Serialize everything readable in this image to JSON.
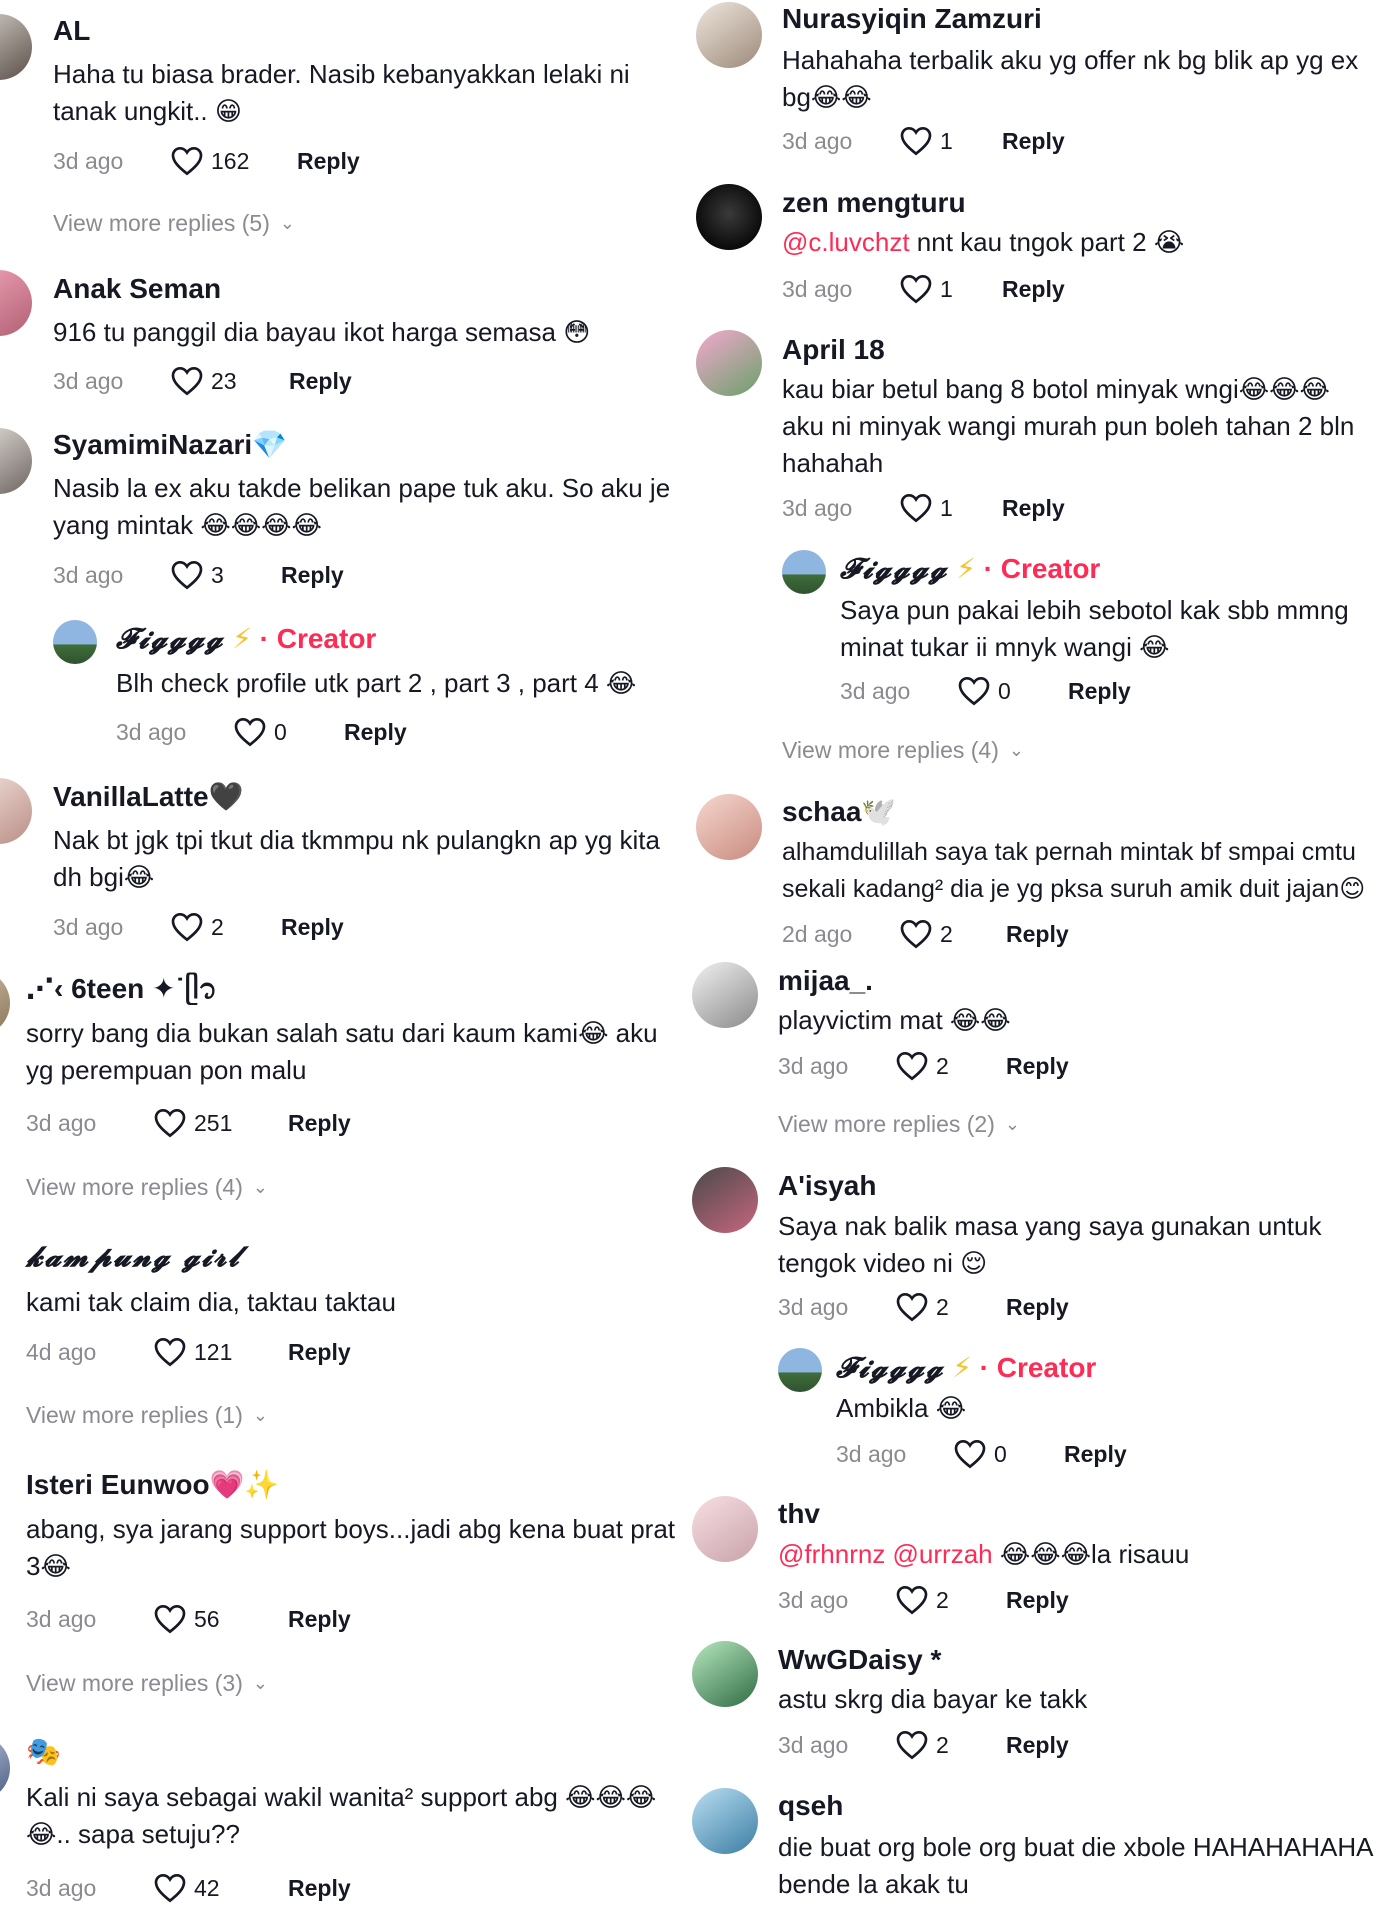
{
  "icons": {
    "like": "heart-outline-icon",
    "expand": "chevron-down-icon"
  },
  "colors": {
    "mention": "#fe2c55",
    "creator": "#fe2c55",
    "muted": "#8a8b91"
  },
  "left": {
    "c1": {
      "name": "AL",
      "text": "Haha tu biasa brader. Nasib kebanyakkan lelaki ni tanak ungkit.. 😁",
      "time": "3d ago",
      "likes": "162",
      "reply": "Reply",
      "more": "View more replies (5)"
    },
    "c2": {
      "name": "Anak Seman",
      "text": "916 tu panggil dia bayau ikot harga semasa 😳",
      "time": "3d ago",
      "likes": "23",
      "reply": "Reply"
    },
    "c3": {
      "name": "SyamimiNazari💎",
      "text": "Nasib la ex aku takde belikan pape tuk aku. So aku je yang mintak 😂😂😂😂",
      "time": "3d ago",
      "likes": "3",
      "reply": "Reply"
    },
    "c3r": {
      "name": "𝓕𝓲𝓰𝓰𝓰𝓰",
      "bolt": "⚡",
      "creator": "· Creator",
      "text": "Blh check profile utk part 2 , part 3 , part 4 😂",
      "time": "3d ago",
      "likes": "0",
      "reply": "Reply"
    },
    "c4": {
      "name": "VanillaLatte🖤",
      "text": "Nak bt jgk tpi tkut dia tkmmpu nk pulangkn ap yg kita dh bgi😂",
      "time": "3d ago",
      "likes": "2",
      "reply": "Reply"
    },
    "c5": {
      "name": "⋰‹ 6teen ✦˙ᥫ᭡",
      "text": "sorry bang dia bukan salah satu dari kaum kami😂 aku yg perempuan pon malu",
      "time": "3d ago",
      "likes": "251",
      "reply": "Reply",
      "more": "View more replies (4)"
    },
    "c6": {
      "name": "𝓴𝓪𝓶𝓹𝓾𝓷𝓰 𝓰𝓲𝓻𝓵",
      "text": "kami tak claim dia, taktau taktau",
      "time": "4d ago",
      "likes": "121",
      "reply": "Reply",
      "more": "View more replies (1)"
    },
    "c7": {
      "name": "Isteri Eunwoo💗✨",
      "text": "abang, sya jarang support boys...jadi abg kena buat prat 3😂",
      "time": "3d ago",
      "likes": "56",
      "reply": "Reply",
      "more": "View more replies (3)"
    },
    "c8": {
      "name": "🎭",
      "text": "Kali ni saya sebagai wakil wanita² support abg 😂😂😂😂.. sapa setuju??",
      "time": "3d ago",
      "likes": "42",
      "reply": "Reply"
    }
  },
  "right": {
    "c1": {
      "name": "Nurasyiqin Zamzuri",
      "text": "Hahahaha terbalik aku yg offer nk bg blik ap yg ex bg😂😂",
      "time": "3d ago",
      "likes": "1",
      "reply": "Reply"
    },
    "c2": {
      "name": "zen mengturu",
      "mention": "@c.luvchzt",
      "text": " nnt kau tngok part 2 😭",
      "time": "3d ago",
      "likes": "1",
      "reply": "Reply"
    },
    "c3": {
      "name": "April 18",
      "text": "kau biar betul bang 8 botol minyak wngi😂😂😂 aku ni minyak wangi murah pun boleh tahan 2 bln hahahah",
      "time": "3d ago",
      "likes": "1",
      "reply": "Reply"
    },
    "c3r": {
      "name": "𝓕𝓲𝓰𝓰𝓰𝓰",
      "bolt": "⚡",
      "creator": "· Creator",
      "text": "Saya pun pakai lebih sebotol kak sbb mmng minat tukar ii mnyk wangi 😂",
      "time": "3d ago",
      "likes": "0",
      "reply": "Reply",
      "more": "View more replies (4)"
    },
    "c4": {
      "name": "schaa🕊️",
      "text": "alhamdulillah saya tak pernah mintak bf smpai cmtu sekali kadang² dia je yg pksa suruh amik duit jajan😊",
      "time": "2d ago",
      "likes": "2",
      "reply": "Reply"
    },
    "c5": {
      "name": "mijaa_.",
      "text": "playvictim mat 😂😂",
      "time": "3d ago",
      "likes": "2",
      "reply": "Reply",
      "more": "View more replies (2)"
    },
    "c6": {
      "name": "A'isyah",
      "text": "Saya nak balik masa yang saya gunakan untuk tengok video ni 😌",
      "time": "3d ago",
      "likes": "2",
      "reply": "Reply"
    },
    "c6r": {
      "name": "𝓕𝓲𝓰𝓰𝓰𝓰",
      "bolt": "⚡",
      "creator": "· Creator",
      "text": "Ambikla 😂",
      "time": "3d ago",
      "likes": "0",
      "reply": "Reply"
    },
    "c7": {
      "name": "thv",
      "mention": "@frhnrnz @urrzah",
      "text": " 😂😂😂la risauu",
      "time": "3d ago",
      "likes": "2",
      "reply": "Reply"
    },
    "c8": {
      "name": "WwGDaisy *",
      "text": "astu skrg dia bayar ke takk",
      "time": "3d ago",
      "likes": "2",
      "reply": "Reply"
    },
    "c9": {
      "name": "qseh",
      "text": "die buat org bole org buat die xbole HAHAHAHAHA bende la akak tu"
    }
  }
}
